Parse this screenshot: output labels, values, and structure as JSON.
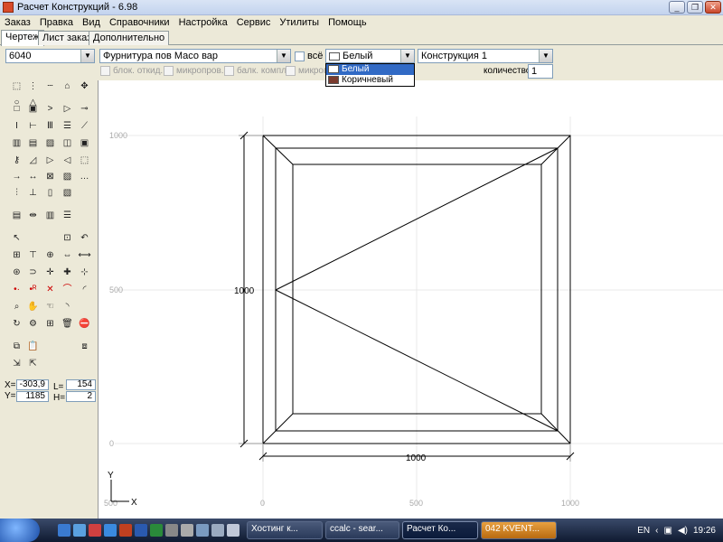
{
  "window": {
    "title": "Расчет Конструкций - 6.98"
  },
  "menu": [
    "Заказ",
    "Правка",
    "Вид",
    "Справочники",
    "Настройка",
    "Сервис",
    "Утилиты",
    "Помощь"
  ],
  "tabs": [
    "Чертеж",
    "Лист заказа",
    "Дополнительно"
  ],
  "toolbar": {
    "profile": "6040",
    "fittings": "Фурнитура пов Масо вар",
    "all_label": "всё",
    "color": "Белый",
    "construction": "Конструкция 1",
    "color_options": [
      "Белый",
      "Коричневый"
    ],
    "option_checks": [
      "блок. откид.",
      "микропров.",
      "балк. компл",
      "микроп"
    ],
    "quantity_label": "количество",
    "quantity_value": "1",
    "swatches": {
      "white": "#ffffff",
      "brown": "#7a3b2e"
    }
  },
  "coords": {
    "x_label": "X=",
    "x_value": "-303,9",
    "y_label": "Y=",
    "y_value": "1185",
    "l_label": "L=",
    "l_value": "154",
    "h_label": "H=",
    "h_value": "2"
  },
  "drawing": {
    "axis_y_labels": [
      "1000",
      "500",
      "0"
    ],
    "axis_x_labels": [
      "500",
      "0",
      "500",
      "1000"
    ],
    "height_dim": "1000",
    "width_dim": "1000",
    "axis_x_name": "X",
    "axis_y_name": "Y"
  },
  "taskbar": {
    "buttons": [
      "Хостинг к...",
      "ccalc - sear...",
      "Расчет Ко...",
      "042 KVENT..."
    ],
    "lang": "EN",
    "time": "19:26"
  }
}
